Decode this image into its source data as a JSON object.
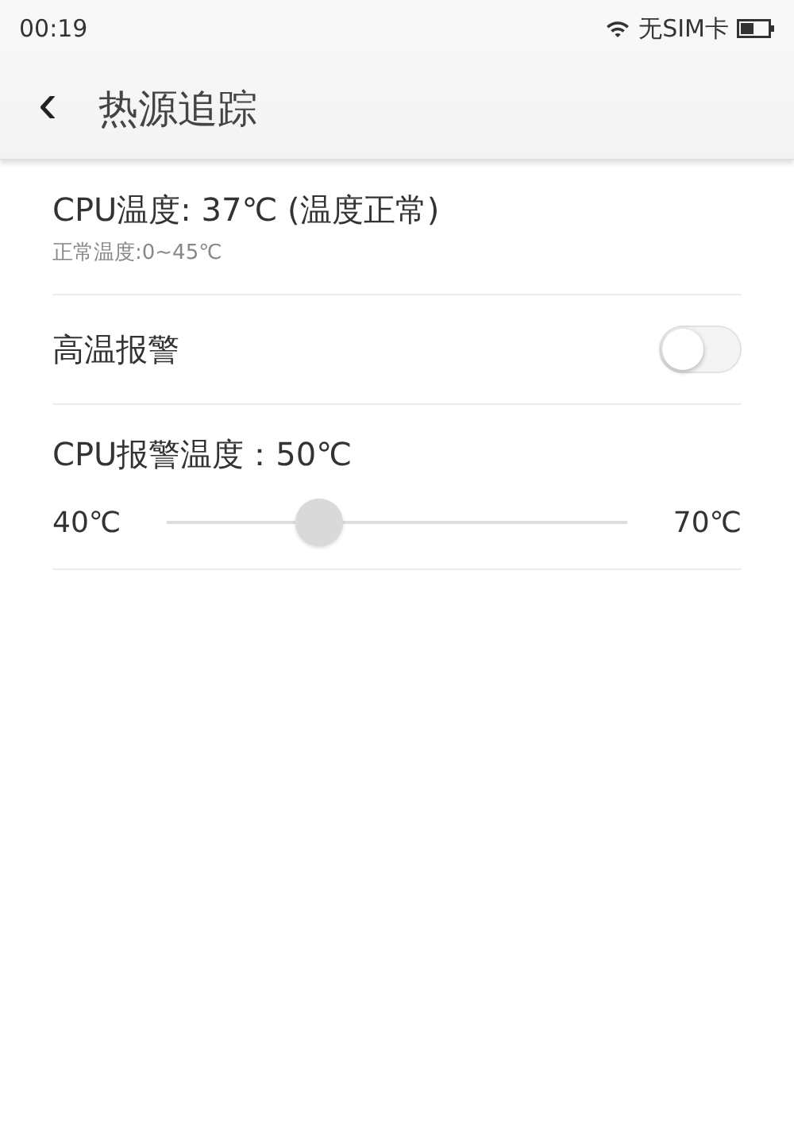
{
  "status_bar": {
    "time": "00:19",
    "carrier": "无SIM卡"
  },
  "header": {
    "back": "‹",
    "title": "热源追踪"
  },
  "cpu": {
    "title": "CPU温度: 37℃  (温度正常)",
    "subtitle": "正常温度:0~45℃"
  },
  "alarm": {
    "label": "高温报警",
    "on": false
  },
  "threshold": {
    "label": "CPU报警温度：50℃",
    "min": "40℃",
    "max": "70℃",
    "level": 0.33
  }
}
